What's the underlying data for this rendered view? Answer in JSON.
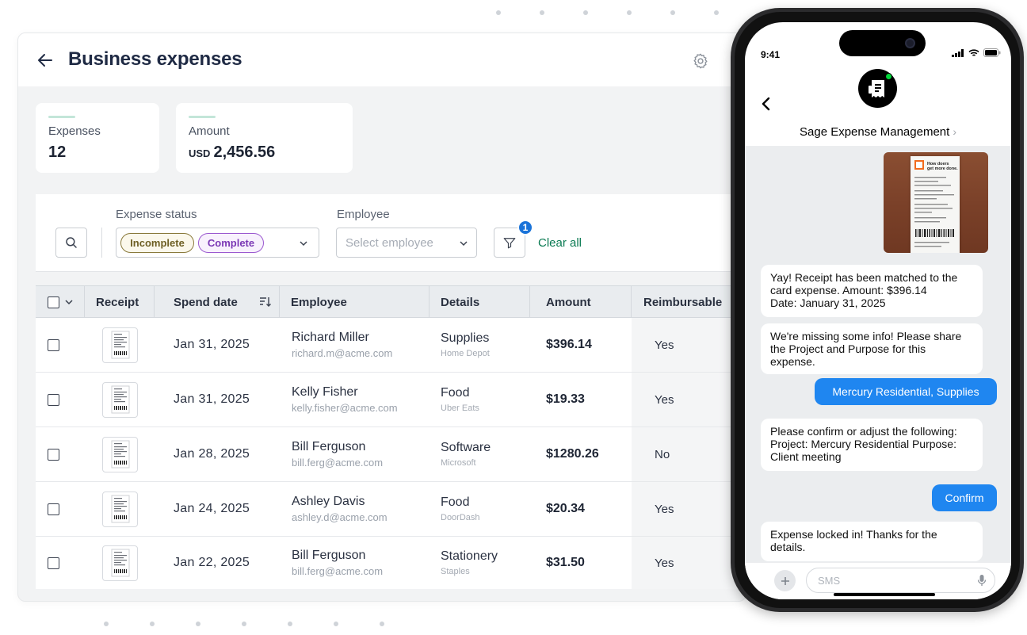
{
  "header": {
    "title": "Business expenses"
  },
  "stats": {
    "expenses_label": "Expenses",
    "expenses_value": "12",
    "amount_label": "Amount",
    "amount_currency": "USD",
    "amount_value": "2,456.56"
  },
  "filters": {
    "status_label": "Expense status",
    "status_chips": [
      "Incomplete",
      "Complete"
    ],
    "employee_label": "Employee",
    "employee_placeholder": "Select employee",
    "active_filter_count": "1",
    "clear_all": "Clear all"
  },
  "table": {
    "columns": [
      "Receipt",
      "Spend date",
      "Employee",
      "Details",
      "Amount",
      "Reimbursable"
    ],
    "rows": [
      {
        "date": "Jan 31, 2025",
        "name": "Richard Miller",
        "email": "richard.m@acme.com",
        "category": "Supplies",
        "vendor": "Home Depot",
        "amount": "$396.14",
        "reimbursable": "Yes"
      },
      {
        "date": "Jan 31, 2025",
        "name": "Kelly Fisher",
        "email": "kelly.fisher@acme.com",
        "category": "Food",
        "vendor": "Uber Eats",
        "amount": "$19.33",
        "reimbursable": "Yes"
      },
      {
        "date": "Jan 28, 2025",
        "name": "Bill Ferguson",
        "email": "bill.ferg@acme.com",
        "category": "Software",
        "vendor": "Microsoft",
        "amount": "$1280.26",
        "reimbursable": "No"
      },
      {
        "date": "Jan 24, 2025",
        "name": "Ashley Davis",
        "email": "ashley.d@acme.com",
        "category": "Food",
        "vendor": "DoorDash",
        "amount": "$20.34",
        "reimbursable": "Yes"
      },
      {
        "date": "Jan 22, 2025",
        "name": "Bill Ferguson",
        "email": "bill.ferg@acme.com",
        "category": "Stationery",
        "vendor": "Staples",
        "amount": "$31.50",
        "reimbursable": "Yes"
      }
    ]
  },
  "phone": {
    "time": "9:41",
    "contact": "Sage Expense Management",
    "receipt_slogan": "How doers get more done.",
    "messages": [
      {
        "from": "bot",
        "lines": [
          "Yay! Receipt has been matched to the",
          "card expense. Amount: $396.14",
          "Date: January 31, 2025"
        ]
      },
      {
        "from": "bot",
        "lines": [
          "We're missing some info! Please share",
          "the Project and Purpose for this expense."
        ]
      },
      {
        "from": "user",
        "lines": [
          "Mercury Residential, Supplies"
        ]
      },
      {
        "from": "bot",
        "lines": [
          "Please confirm or adjust the following:",
          "Project: Mercury Residential Purpose:",
          "Client meeting"
        ]
      },
      {
        "from": "user",
        "lines": [
          "Confirm"
        ]
      },
      {
        "from": "bot",
        "lines": [
          "Expense locked in! Thanks for the",
          "details."
        ]
      }
    ],
    "compose_placeholder": "SMS"
  },
  "colors": {
    "accent_green": "#0a7a52",
    "incomplete_chip": "#8a7a3c",
    "complete_chip": "#9b59d0",
    "imessage_blue": "#1f86f0",
    "badge_blue": "#1a73d9"
  },
  "icons": [
    "back-arrow-icon",
    "gear-icon",
    "search-icon",
    "chevron-down-icon",
    "filter-icon",
    "sort-icon",
    "receipt-icon",
    "plus-icon",
    "mic-icon",
    "signal-icon",
    "wifi-icon",
    "battery-icon"
  ]
}
